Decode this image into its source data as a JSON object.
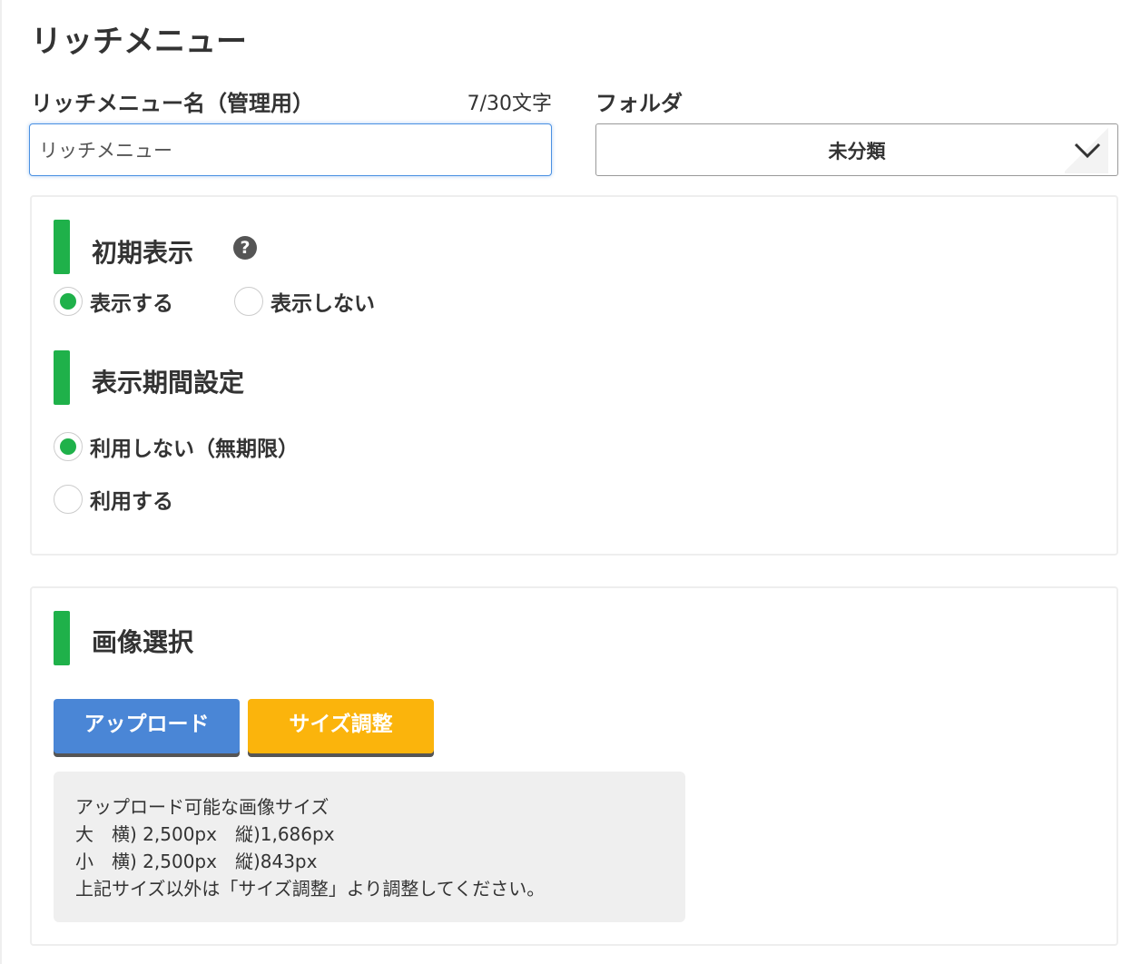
{
  "page": {
    "title": "リッチメニュー"
  },
  "form": {
    "name_label": "リッチメニュー名（管理用）",
    "char_count": "7/30文字",
    "name_value": "リッチメニュー",
    "folder_label": "フォルダ",
    "folder_value": "未分類"
  },
  "initial_display": {
    "title": "初期表示",
    "help_icon": "?",
    "options": [
      {
        "label": "表示する",
        "selected": true
      },
      {
        "label": "表示しない",
        "selected": false
      }
    ]
  },
  "display_period": {
    "title": "表示期間設定",
    "options": [
      {
        "label": "利用しない（無期限）",
        "selected": true
      },
      {
        "label": "利用する",
        "selected": false
      }
    ]
  },
  "image_select": {
    "title": "画像選択",
    "upload_label": "アップロード",
    "resize_label": "サイズ調整",
    "info": [
      "アップロード可能な画像サイズ",
      "大　横) 2,500px　縦)1,686px",
      "小　横) 2,500px　縦)843px",
      "上記サイズ以外は「サイズ調整」より調整してください。"
    ]
  },
  "colors": {
    "accent_green": "#1fb14a",
    "upload_blue": "#4a86d6",
    "resize_orange": "#fbb40c",
    "focus_blue": "#4a90e2"
  }
}
